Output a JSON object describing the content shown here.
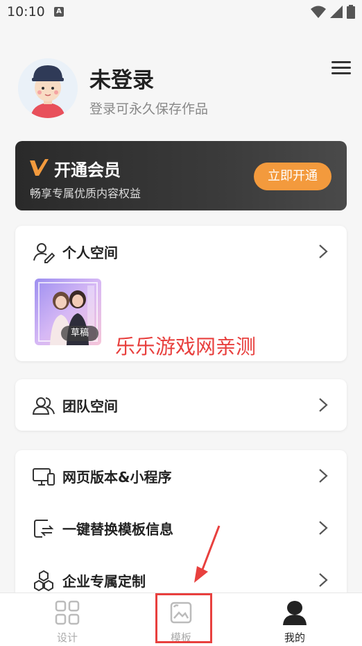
{
  "status": {
    "time": "10:10",
    "a_icon": "A"
  },
  "profile": {
    "name": "未登录",
    "subtitle": "登录可永久保存作品"
  },
  "vip": {
    "title": "开通会员",
    "subtitle": "畅享专属优质内容权益",
    "button": "立即开通",
    "accent": "#f39a3d"
  },
  "personal": {
    "label": "个人空间",
    "draft_tag": "草稿"
  },
  "watermark": "乐乐游戏网亲测",
  "team": {
    "label": "团队空间"
  },
  "tools": [
    {
      "label": "网页版本&小程序",
      "icon": "monitor-phone-icon"
    },
    {
      "label": "一键替换模板信息",
      "icon": "swap-icon"
    },
    {
      "label": "企业专属定制",
      "icon": "hexagon-cluster-icon"
    }
  ],
  "tabs": [
    {
      "label": "设计",
      "icon": "grid-icon"
    },
    {
      "label": "模板",
      "icon": "image-icon"
    },
    {
      "label": "我的",
      "icon": "user-icon"
    }
  ],
  "colors": {
    "highlight": "#e8403e"
  }
}
